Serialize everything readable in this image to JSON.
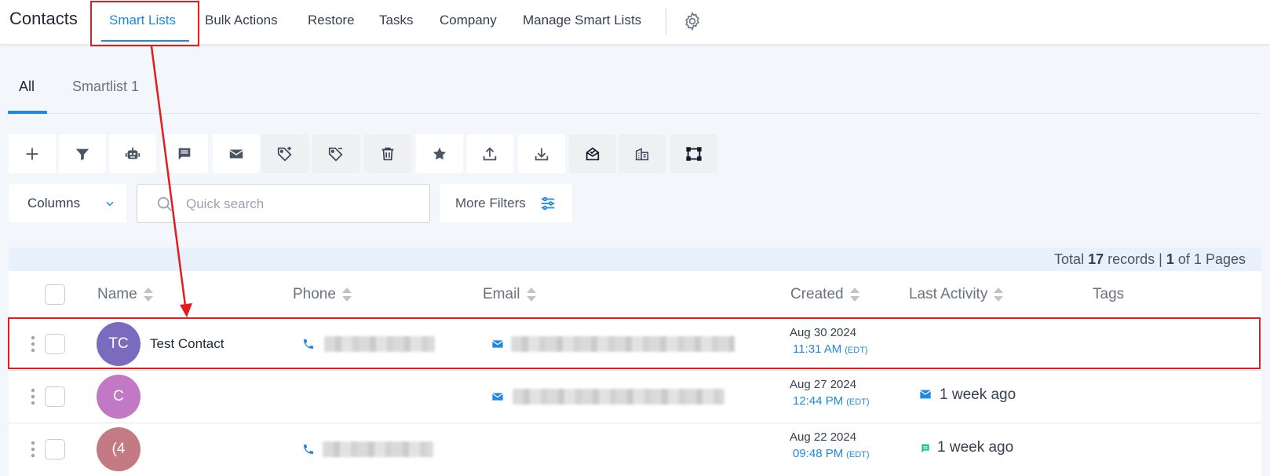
{
  "app": {
    "title": "Contacts"
  },
  "nav": {
    "items": [
      {
        "label": "Smart Lists",
        "active": true
      },
      {
        "label": "Bulk Actions"
      },
      {
        "label": "Restore"
      },
      {
        "label": "Tasks"
      },
      {
        "label": "Company"
      },
      {
        "label": "Manage Smart Lists"
      }
    ],
    "settings_icon": "gear-icon"
  },
  "tabs": [
    {
      "label": "All",
      "active": true
    },
    {
      "label": "Smartlist 1"
    }
  ],
  "toolbar": {
    "icons": [
      "plus-icon",
      "filter-icon",
      "robot-icon",
      "message-icon",
      "email-icon",
      "tag-add-icon",
      "tag-remove-icon",
      "trash-icon",
      "star-icon",
      "upload-icon",
      "download-icon",
      "envelope-open-icon",
      "building-icon",
      "merge-icon"
    ]
  },
  "filters": {
    "columns_label": "Columns",
    "search_placeholder": "Quick search",
    "more_filters_label": "More Filters"
  },
  "table": {
    "summary": {
      "prefix": "Total",
      "records": "17",
      "records_label": "records |",
      "page": "1",
      "of_label": "of",
      "pages": "1",
      "pages_label": "Pages"
    },
    "columns": [
      "Name",
      "Phone",
      "Email",
      "Created",
      "Last Activity",
      "Tags"
    ],
    "rows": [
      {
        "initials": "TC",
        "name": "Test Contact",
        "avatar_color": "#7b6bbf",
        "created_date": "Aug 30 2024",
        "created_time": "11:31 AM",
        "tz": "(EDT)",
        "activity": ""
      },
      {
        "initials": "C",
        "name": "",
        "avatar_color": "#c278c4",
        "created_date": "Aug 27 2024",
        "created_time": "12:44 PM",
        "tz": "(EDT)",
        "activity": "1 week ago"
      },
      {
        "initials": "(4",
        "name": "",
        "avatar_color": "#c47a82",
        "created_date": "Aug 22 2024",
        "created_time": "09:48 PM",
        "tz": "(EDT)",
        "activity": "1 week ago"
      }
    ]
  },
  "colors": {
    "accent": "#1e88e5",
    "annotation": "#e11d1d",
    "chat_green": "#1fc28a"
  }
}
